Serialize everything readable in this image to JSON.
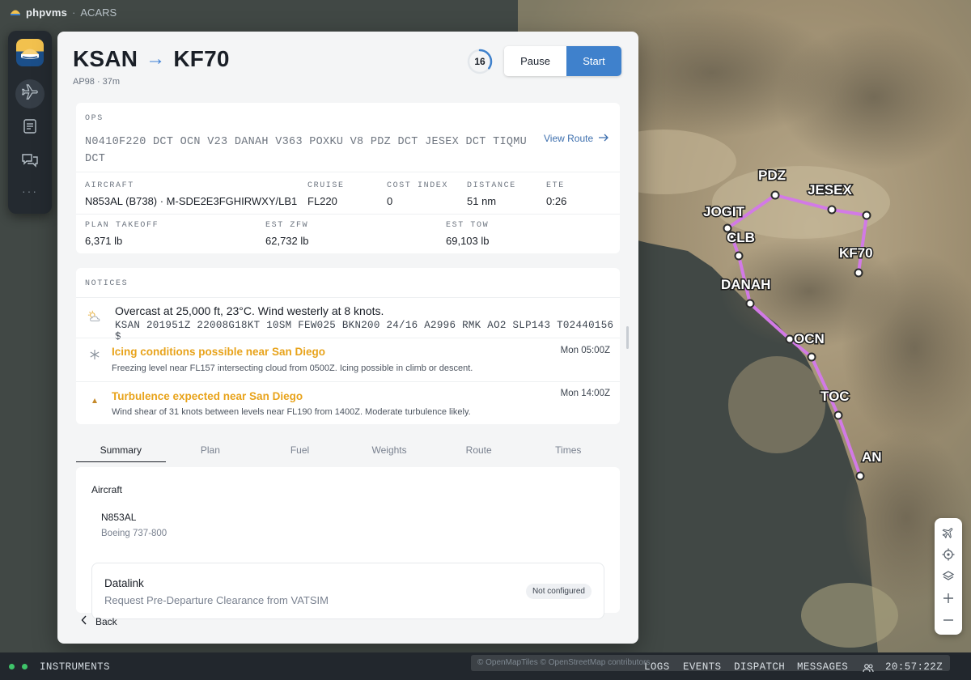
{
  "app": {
    "brand": "phpvms",
    "separator": "·",
    "subtitle": "ACARS"
  },
  "flight": {
    "origin": "KSAN",
    "arrow": "→",
    "destination": "KF70",
    "subtitle": "AP98 · 37m",
    "timer": "16",
    "timer_progress": 0.35,
    "pause_label": "Pause",
    "start_label": "Start"
  },
  "ops": {
    "label": "OPS",
    "route": "N0410F220 DCT OCN V23 DANAH V363 POXKU V8 PDZ DCT JESEX DCT TIQMU DCT",
    "view_route": "View Route",
    "aircraft": {
      "label": "AIRCRAFT",
      "value": "N853AL (B738) · M-SDE2E3FGHIRWXY/LB1"
    },
    "cruise": {
      "label": "CRUISE",
      "value": "FL220"
    },
    "cost_index": {
      "label": "COST INDEX",
      "value": "0"
    },
    "distance": {
      "label": "DISTANCE",
      "value": "51 nm"
    },
    "ete": {
      "label": "ETE",
      "value": "0:26"
    },
    "plan_takeoff": {
      "label": "PLAN TAKEOFF",
      "value": "6,371 lb"
    },
    "est_zfw": {
      "label": "EST ZFW",
      "value": "62,732 lb"
    },
    "est_tow": {
      "label": "EST TOW",
      "value": "69,103 lb"
    }
  },
  "notices": {
    "label": "NOTICES",
    "metar": {
      "summary": "Overcast at 25,000 ft, 23°C. Wind westerly at 8 knots.",
      "raw": "KSAN 201951Z 22008G18KT 10SM FEW025 BKN200 24/16 A2996 RMK AO2 SLP143 T02440156 $"
    },
    "items": [
      {
        "title": "Icing conditions possible near San Diego",
        "time": "Mon 05:00Z",
        "desc": "Freezing level near FL157 intersecting cloud from 0500Z. Icing possible in climb or descent."
      },
      {
        "title": "Turbulence expected near San Diego",
        "time": "Mon 14:00Z",
        "desc": "Wind shear of 31 knots between levels near FL190 from 1400Z. Moderate turbulence likely."
      }
    ]
  },
  "tabs": [
    "Summary",
    "Plan",
    "Fuel",
    "Weights",
    "Route",
    "Times"
  ],
  "summary": {
    "heading": "Aircraft",
    "registration": "N853AL",
    "type": "Boeing 737-800",
    "datalink": {
      "title": "Datalink",
      "subtitle": "Request Pre-Departure Clearance from VATSIM",
      "badge": "Not configured"
    }
  },
  "back_label": "Back",
  "map": {
    "route_color": "#d27ae6",
    "waypoint_labels": [
      "PDZ",
      "JESEX",
      "JOGIT",
      "CLB",
      "KF70",
      "DANAH",
      "OCN",
      "TOC",
      "AN"
    ],
    "attribution": "© OpenMapTiles © OpenStreetMap contributors"
  },
  "bottombar": {
    "instruments": "INSTRUMENTS",
    "logs": "LOGS",
    "events": "EVENTS",
    "dispatch": "DISPATCH",
    "messages": "MESSAGES",
    "clock": "20:57:22Z"
  },
  "colors": {
    "accent": "#3f81cc",
    "warning": "#e8a31b",
    "status_ok": "#3fc46a"
  }
}
